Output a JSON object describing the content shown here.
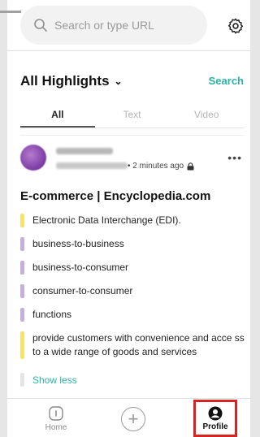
{
  "browser": {
    "search_placeholder": "Search or type URL",
    "icons": {
      "search": "search-icon",
      "settings": "gear-icon"
    }
  },
  "header": {
    "title": "All Highlights",
    "search_label": "Search"
  },
  "tabs": [
    {
      "label": "All",
      "active": true
    },
    {
      "label": "Text",
      "active": false
    },
    {
      "label": "Video",
      "active": false
    }
  ],
  "card": {
    "time": "• 2 minutes ago",
    "more": "•••",
    "title": "E-commerce | Encyclopedia.com",
    "highlights": [
      {
        "text": "Electronic Data Interchange (EDI).",
        "color": "#f2e56b"
      },
      {
        "text": "business-to-business",
        "color": "#c5aee0"
      },
      {
        "text": "business-to-consumer",
        "color": "#c5aee0"
      },
      {
        "text": "consumer-to-consumer",
        "color": "#c5aee0"
      },
      {
        "text": "functions",
        "color": "#c5aee0"
      },
      {
        "text": "provide customers with convenience and acce ss to a wide range of goods and services",
        "color": "#f2e56b"
      }
    ],
    "show_less": "Show less"
  },
  "bottom_nav": {
    "home": "Home",
    "profile": "Profile"
  },
  "colors": {
    "accent": "#2fb2a6",
    "highlight_box": "#d92323"
  }
}
